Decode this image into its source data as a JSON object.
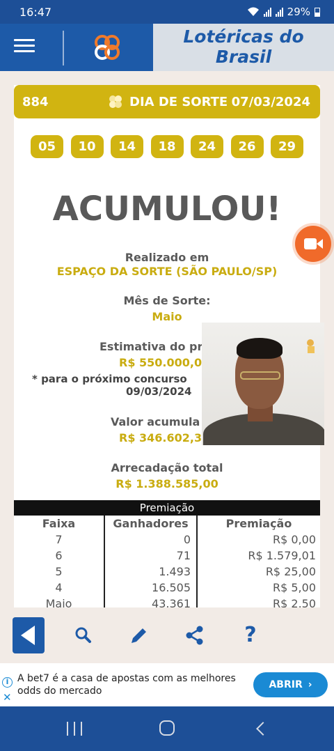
{
  "status_bar": {
    "time": "16:47",
    "battery": "29%"
  },
  "header": {
    "brand_line1": "Lotéricas do",
    "brand_line2": "Brasil"
  },
  "result": {
    "contest_number": "884",
    "game_name": "DIA DE SORTE",
    "draw_date": "07/03/2024",
    "numbers": [
      "05",
      "10",
      "14",
      "18",
      "24",
      "26",
      "29"
    ],
    "headline": "ACUMULOU!",
    "realized_label": "Realizado em",
    "realized_place": "ESPAÇO DA SORTE (SÃO PAULO/SP)",
    "lucky_month_label": "Mês de Sorte:",
    "lucky_month": "Maio",
    "estimate_label": "Estimativa do pr",
    "estimate_value": "R$ 550.000,0",
    "next_contest_note": "* para o próximo concurso",
    "next_contest_date": "09/03/2024",
    "accumulated_label": "Valor acumula",
    "accumulated_value": "R$ 346.602,3",
    "total_label": "Arrecadação total",
    "total_value": "R$ 1.388.585,00"
  },
  "prize_table": {
    "title": "Premiação",
    "headers": {
      "tier": "Faixa",
      "winners": "Ganhadores",
      "prize": "Premiação"
    },
    "rows": [
      {
        "tier": "7",
        "winners": "0",
        "prize": "R$ 0,00"
      },
      {
        "tier": "6",
        "winners": "71",
        "prize": "R$ 1.579,01"
      },
      {
        "tier": "5",
        "winners": "1.493",
        "prize": "R$ 25,00"
      },
      {
        "tier": "4",
        "winners": "16.505",
        "prize": "R$ 5,00"
      },
      {
        "tier": "Maio",
        "winners": "43.361",
        "prize": "R$ 2,50"
      }
    ]
  },
  "toolbar": {
    "icons": [
      "back-icon",
      "search-icon",
      "pencil-icon",
      "share-icon",
      "help-icon"
    ],
    "help_glyph": "?"
  },
  "ad": {
    "text": "A bet7 é a casa de apostas com as melhores odds do mercado",
    "cta": "ABRIR",
    "info_glyph": "i",
    "close_glyph": "✕"
  },
  "colors": {
    "brand_blue": "#1d5aa8",
    "gold": "#d1b411",
    "video_orange": "#f06a2a",
    "ad_blue": "#1a8ad4"
  }
}
